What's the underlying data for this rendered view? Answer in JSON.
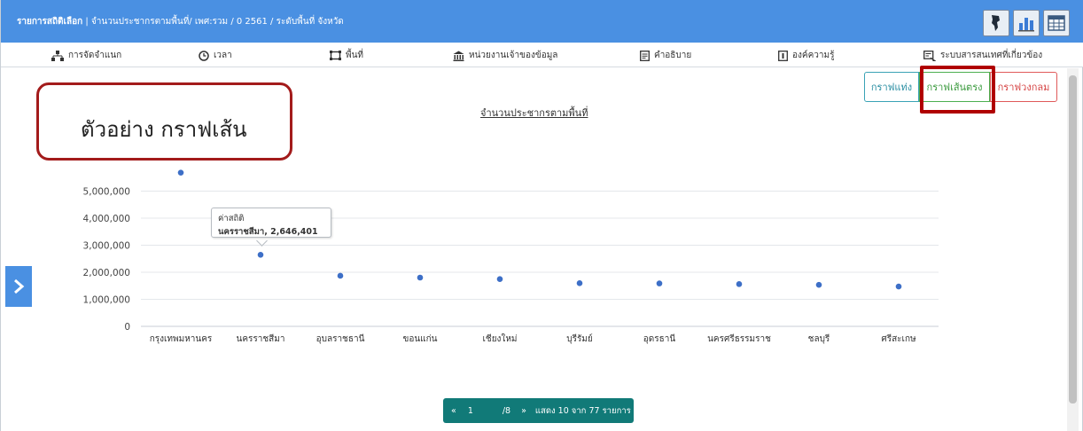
{
  "header": {
    "title_bold": "รายการสถิติเลือก",
    "title_rest": " | จำนวนประชากรตามพื้นที่/ เพศ:รวม / 0 2561 / ระดับพื้นที่ จังหวัด",
    "icons": [
      "map-icon",
      "chart-icon",
      "table-icon"
    ]
  },
  "menu": {
    "items": [
      {
        "label": "การจัดจำแนก",
        "icon": "hierarchy-icon"
      },
      {
        "label": "เวลา",
        "icon": "clock-icon"
      },
      {
        "label": "พื้นที่",
        "icon": "area-icon"
      },
      {
        "label": "หน่วยงานเจ้าของข้อมูล",
        "icon": "institution-icon"
      },
      {
        "label": "คำอธิบาย",
        "icon": "document-icon"
      },
      {
        "label": "องค์ความรู้",
        "icon": "book-icon"
      },
      {
        "label": "ระบบสารสนเทศที่เกี่ยวข้อง",
        "icon": "link-window-icon"
      }
    ]
  },
  "annotation": {
    "label": "ตัวอย่าง กราฟเส้น"
  },
  "chart_type_buttons": {
    "bar": "กราฟแท่ง",
    "line": "กราฟเส้นตรง",
    "pie": "กราฟวงกลม"
  },
  "tooltip": {
    "line1": "ค่าสถิติ",
    "line2": "นครราชสีมา, 2,646,401"
  },
  "pager": {
    "prev": "«",
    "current": "1",
    "total": "/8",
    "next": "»",
    "summary": "แสดง 10 จาก 77 รายการ"
  },
  "colors": {
    "header": "#4a90e2",
    "point": "#3d6fc7",
    "pager": "#117a78",
    "highlight": "#b00000"
  },
  "chart_data": {
    "type": "scatter",
    "title": "จำนวนประชากรตามพื้นที่",
    "categories": [
      "กรุงเทพมหานคร",
      "นครราชสีมา",
      "อุบลราชธานี",
      "ขอนแก่น",
      "เชียงใหม่",
      "บุรีรัมย์",
      "อุดรธานี",
      "นครศรีธรรมราช",
      "ชลบุรี",
      "ศรีสะเกษ"
    ],
    "series": [
      {
        "values": [
          5682415,
          2646401,
          1869633,
          1802872,
          1746840,
          1595747,
          1586646,
          1561927,
          1535445,
          1472859
        ]
      }
    ],
    "yticks": [
      0,
      1000000,
      2000000,
      3000000,
      4000000,
      5000000
    ],
    "ytick_labels": [
      "0",
      "1,000,000",
      "2,000,000",
      "3,000,000",
      "4,000,000",
      "5,000,000"
    ],
    "ylim": [
      0,
      5700000
    ],
    "grid": true,
    "xlabel": "",
    "ylabel": ""
  }
}
